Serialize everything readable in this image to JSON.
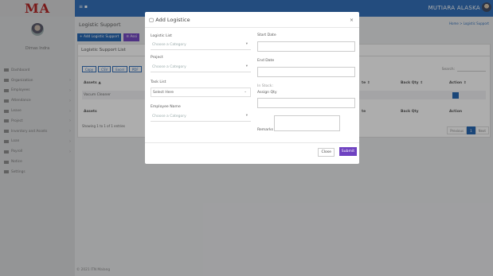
{
  "app": {
    "logo": "MA",
    "brand": "MUTIARA ALASKA",
    "user_name": "Dimas Indra"
  },
  "sidebar": {
    "items": [
      {
        "label": "Dashboard",
        "chev": ""
      },
      {
        "label": "Organization",
        "chev": "›"
      },
      {
        "label": "Employees",
        "chev": "›"
      },
      {
        "label": "Attendance",
        "chev": "›"
      },
      {
        "label": "Leave",
        "chev": "›"
      },
      {
        "label": "Project",
        "chev": "›"
      },
      {
        "label": "Inventory and Assets",
        "chev": "›"
      },
      {
        "label": "Loan",
        "chev": "›"
      },
      {
        "label": "Payroll",
        "chev": "›"
      },
      {
        "label": "Notice",
        "chev": ""
      },
      {
        "label": "Settings",
        "chev": ""
      }
    ]
  },
  "page": {
    "title": "Logistic Support",
    "breadcrumb": "Home > Logistic Support",
    "add_button": "+ Add Logistic Support",
    "second_button": "≡ Assi",
    "card_title": "Logistic Support List",
    "export": [
      "Copy",
      "CSV",
      "Excel",
      "PDF"
    ],
    "search_label": "Search:",
    "columns": [
      "Assets",
      "te",
      "Back Qty",
      "Action"
    ],
    "column_arrows": [
      "▲",
      "⇕",
      "⇕",
      "⇕"
    ],
    "row": {
      "asset": "Vacum Cleaner",
      "edit_icon": "edit-icon"
    },
    "footer_cols": [
      "Assets",
      "te",
      "Back Qty",
      "Action"
    ],
    "showing": "Showing 1 to 1 of 1 entries",
    "pager": {
      "prev": "Previous",
      "current": "1",
      "next": "Next"
    }
  },
  "footer": "© 2021 ITN Malang",
  "modal": {
    "title": "Add Logistice",
    "close_x": "×",
    "logistic_list": {
      "label": "Logistic List",
      "placeholder": "Choose a Category"
    },
    "project": {
      "label": "Project",
      "placeholder": "Choose a Category"
    },
    "task_list": {
      "label": "Task List",
      "value": "Select Here"
    },
    "employee": {
      "label": "Employee Name",
      "placeholder": "Choose a Category"
    },
    "start_date": {
      "label": "Start Date",
      "value": ""
    },
    "end_date": {
      "label": "End Date",
      "value": ""
    },
    "in_stock": {
      "label": "In Stock:"
    },
    "assign_qty": {
      "label": "Assign Qty",
      "value": ""
    },
    "remarks": {
      "label": "Remarks",
      "value": ""
    },
    "buttons": {
      "close": "Close",
      "submit": "Submit"
    }
  },
  "colors": {
    "primary": "#2b6bb7",
    "accent": "#6f42c1",
    "logo": "#b01c1c"
  }
}
